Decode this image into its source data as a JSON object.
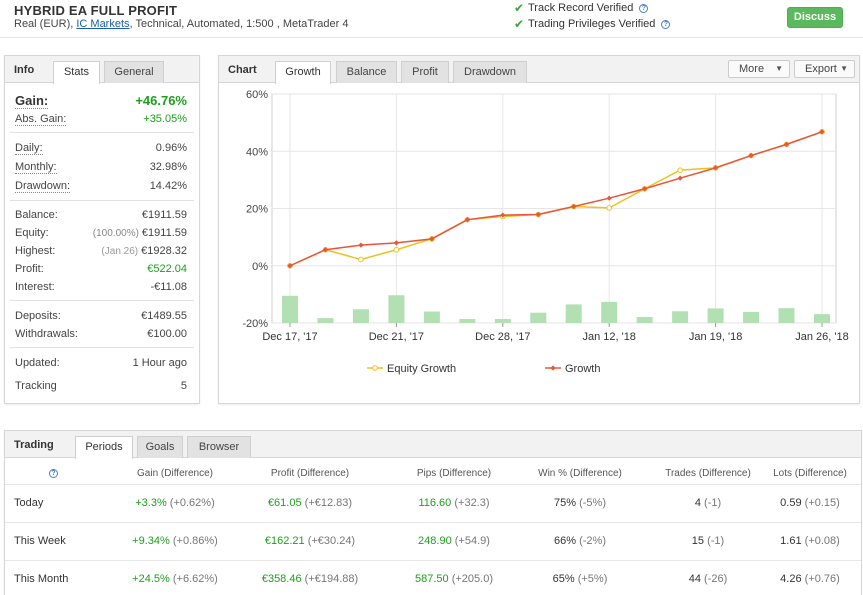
{
  "header": {
    "title": "HYBRID EA FULL PROFIT",
    "subtitle_pre": "Real (EUR), ",
    "broker": "IC Markets",
    "subtitle_post": ", Technical, Automated, 1:500 , MetaTrader 4",
    "verified": [
      "Track Record Verified",
      "Trading Privileges Verified"
    ],
    "discuss_label": "Discuss"
  },
  "info": {
    "title": "Info",
    "tabs": [
      "Stats",
      "General"
    ],
    "gain": {
      "label": "Gain:",
      "value": "+46.76%"
    },
    "abs_gain": {
      "label": "Abs. Gain:",
      "value": "+35.05%"
    },
    "daily": {
      "label": "Daily:",
      "value": "0.96%"
    },
    "monthly": {
      "label": "Monthly:",
      "value": "32.98%"
    },
    "drawdown": {
      "label": "Drawdown:",
      "value": "14.42%"
    },
    "balance": {
      "label": "Balance:",
      "value": "€1911.59"
    },
    "equity": {
      "label": "Equity:",
      "pct": "(100.00%)",
      "value": "€1911.59"
    },
    "highest": {
      "label": "Highest:",
      "date": "(Jan 26)",
      "value": "€1928.32"
    },
    "profit": {
      "label": "Profit:",
      "value": "€522.04"
    },
    "interest": {
      "label": "Interest:",
      "value": "-€11.08"
    },
    "deposits": {
      "label": "Deposits:",
      "value": "€1489.55"
    },
    "withdrawals": {
      "label": "Withdrawals:",
      "value": "€100.00"
    },
    "updated": {
      "label": "Updated:",
      "value": "1 Hour ago"
    },
    "tracking": {
      "label": "Tracking",
      "value": "5"
    }
  },
  "chart_panel": {
    "title": "Chart",
    "tabs": [
      "Growth",
      "Balance",
      "Profit",
      "Drawdown"
    ],
    "more_label": "More",
    "export_label": "Export"
  },
  "chart_data": {
    "type": "line",
    "title": "",
    "xlabel": "",
    "ylabel": "",
    "ylim": [
      -20,
      60
    ],
    "y_ticks": [
      "60%",
      "40%",
      "20%",
      "0%",
      "-20%"
    ],
    "y_tick_values": [
      60,
      40,
      20,
      0,
      -20
    ],
    "x_tick_labels": [
      "Dec 17, '17",
      "Dec 21, '17",
      "Dec 28, '17",
      "Jan 12, '18",
      "Jan 19, '18",
      "Jan 26, '18"
    ],
    "point_count": 16,
    "series": [
      {
        "name": "Equity Growth",
        "color": "#f0c020",
        "values": [
          0,
          5.6,
          2.2,
          5.6,
          9.4,
          16.1,
          17.2,
          17.9,
          20.7,
          20.2,
          26.9,
          33.4,
          34.2,
          38.5,
          42.4,
          46.8
        ]
      },
      {
        "name": "Growth",
        "color": "#e8553a",
        "values": [
          0,
          5.6,
          7.2,
          8.0,
          9.4,
          16.1,
          17.7,
          17.9,
          20.7,
          23.6,
          26.9,
          30.6,
          34.2,
          38.5,
          42.4,
          46.8
        ]
      }
    ],
    "bars": {
      "color": "#b3e0b3",
      "values": [
        -10.5,
        -18.3,
        -15.2,
        -10.3,
        -16.0,
        -18.6,
        -18.6,
        -16.4,
        -13.5,
        -12.6,
        -17.9,
        -15.9,
        -14.9,
        -16.1,
        -14.8,
        -16.9
      ]
    },
    "grid": true,
    "legend_position": "bottom"
  },
  "trading": {
    "title": "Trading",
    "tabs": [
      "Periods",
      "Goals",
      "Browser"
    ],
    "columns": [
      "Gain (Difference)",
      "Profit (Difference)",
      "Pips (Difference)",
      "Win % (Difference)",
      "Trades (Difference)",
      "Lots (Difference)"
    ],
    "rows": [
      {
        "period": "Today",
        "gain": "+3.3%",
        "gain_diff": "(+0.62%)",
        "profit": "€61.05",
        "profit_diff": "(+€12.83)",
        "pips": "116.60",
        "pips_diff": "(+32.3)",
        "win": "75%",
        "win_diff": "(-5%)",
        "trades": "4",
        "trades_diff": "(-1)",
        "lots": "0.59",
        "lots_diff": "(+0.15)"
      },
      {
        "period": "This Week",
        "gain": "+9.34%",
        "gain_diff": "(+0.86%)",
        "profit": "€162.21",
        "profit_diff": "(+€30.24)",
        "pips": "248.90",
        "pips_diff": "(+54.9)",
        "win": "66%",
        "win_diff": "(-2%)",
        "trades": "15",
        "trades_diff": "(-1)",
        "lots": "1.61",
        "lots_diff": "(+0.08)"
      },
      {
        "period": "This Month",
        "gain": "+24.5%",
        "gain_diff": "(+6.62%)",
        "profit": "€358.46",
        "profit_diff": "(+€194.88)",
        "pips": "587.50",
        "pips_diff": "(+205.0)",
        "win": "65%",
        "win_diff": "(+5%)",
        "trades": "44",
        "trades_diff": "(-26)",
        "lots": "4.26",
        "lots_diff": "(+0.76)"
      }
    ]
  },
  "colors": {
    "accent_green": "#5cb85c",
    "positive": "#1e9e1e",
    "link": "#1a5fa8"
  },
  "icons": [
    "check-icon",
    "help-icon",
    "chevron-down-icon"
  ]
}
